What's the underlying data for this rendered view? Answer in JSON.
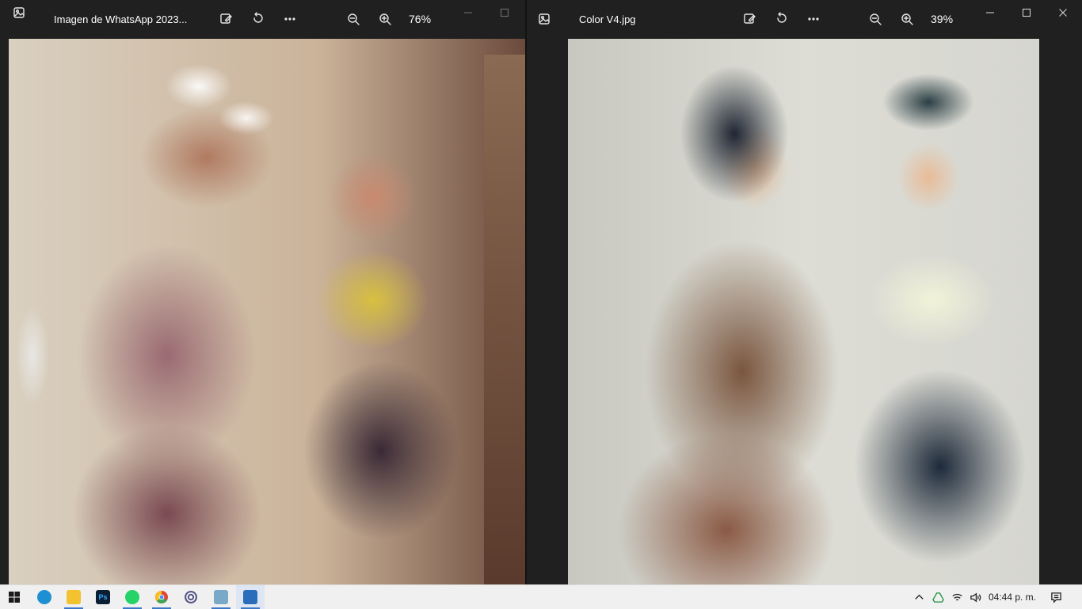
{
  "left_window": {
    "title": "Imagen de WhatsApp 2023...",
    "zoom": "76%",
    "icons": {
      "app": "photos-app-icon",
      "edit": "edit-image-icon",
      "rotate": "rotate-icon",
      "more": "more-options-icon",
      "zoom_out": "zoom-out-icon",
      "zoom_in": "zoom-in-icon"
    },
    "image": "damaged-vintage-photo-woman-and-child"
  },
  "right_window": {
    "title": "Color V4.jpg",
    "zoom": "39%",
    "icons": {
      "app": "photos-app-icon",
      "edit": "edit-image-icon",
      "rotate": "rotate-icon",
      "more": "more-options-icon",
      "zoom_out": "zoom-out-icon",
      "zoom_in": "zoom-in-icon"
    },
    "image": "restored-colorized-photo-woman-and-child"
  },
  "taskbar": {
    "apps": [
      {
        "name": "windows-start-icon",
        "color": "#1a1a1a"
      },
      {
        "name": "edge-icon",
        "color": "#1f8fd4"
      },
      {
        "name": "file-explorer-icon",
        "color": "#f2c230"
      },
      {
        "name": "photoshop-icon",
        "color": "#0b1e33"
      },
      {
        "name": "whatsapp-icon",
        "color": "#25d366"
      },
      {
        "name": "chrome-icon",
        "color": "#e0463a"
      },
      {
        "name": "app-spiral-icon",
        "color": "#5a5a8a"
      },
      {
        "name": "notepad-icon",
        "color": "#7aa8c8"
      },
      {
        "name": "photos-icon",
        "color": "#2a6ebb"
      }
    ],
    "clock": "04:44 p. m."
  }
}
